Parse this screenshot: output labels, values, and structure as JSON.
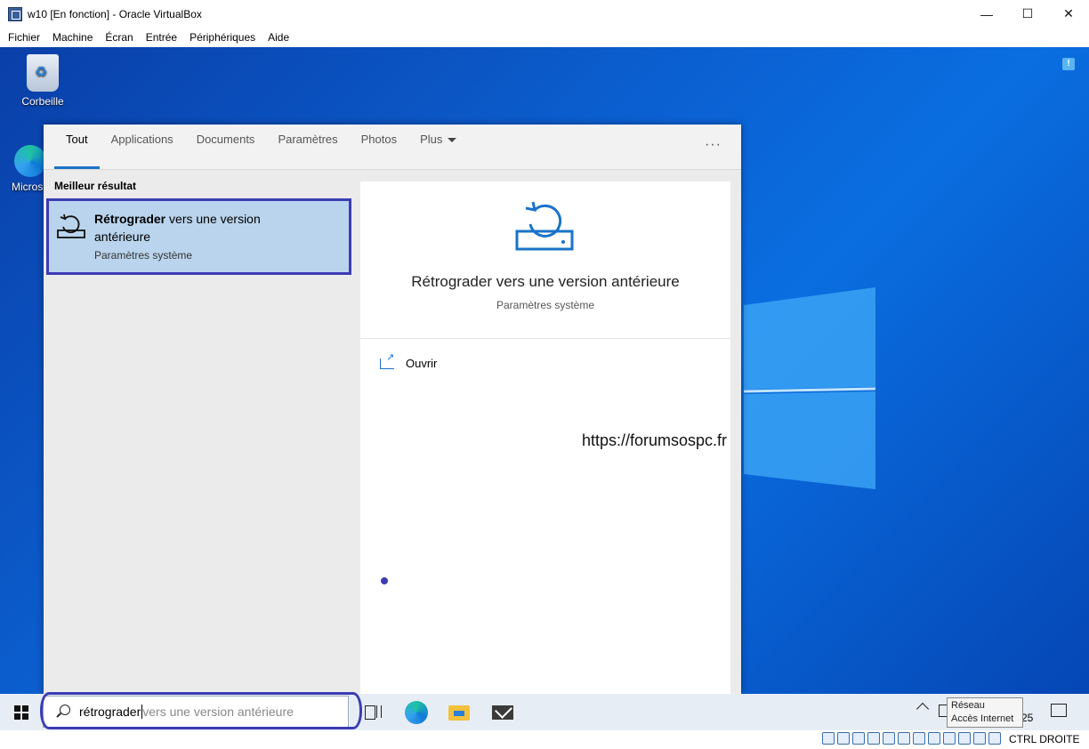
{
  "window": {
    "title": "w10 [En fonction] - Oracle VirtualBox",
    "minimize": "—",
    "maximize": "☐",
    "close": "✕"
  },
  "menu": [
    "Fichier",
    "Machine",
    "Écran",
    "Entrée",
    "Périphériques",
    "Aide"
  ],
  "desktop": {
    "recycle_label": "Corbeille",
    "edge_label": "Microso"
  },
  "search": {
    "tabs": [
      "Tout",
      "Applications",
      "Documents",
      "Paramètres",
      "Photos",
      "Plus"
    ],
    "more": "···",
    "best_label": "Meilleur résultat",
    "best": {
      "title_bold": "Rétrograder",
      "title_rest": " vers une version antérieure",
      "subtitle": "Paramètres système"
    },
    "preview": {
      "title": "Rétrograder vers une version antérieure",
      "subtitle": "Paramètres système",
      "open": "Ouvrir"
    }
  },
  "watermark": "https://forumsospc.fr",
  "taskbar": {
    "search_typed": "rétrograder",
    "search_hint": "vers une version antérieure",
    "clock_fragment": "25",
    "tooltip_line1": "Réseau",
    "tooltip_line2": "Accès Internet"
  },
  "statusbar": {
    "host_key": "CTRL DROITE"
  },
  "colors": {
    "accent": "#1a73c8",
    "highlight_border": "#3c3cb4",
    "best_bg": "#b9d4ec"
  }
}
